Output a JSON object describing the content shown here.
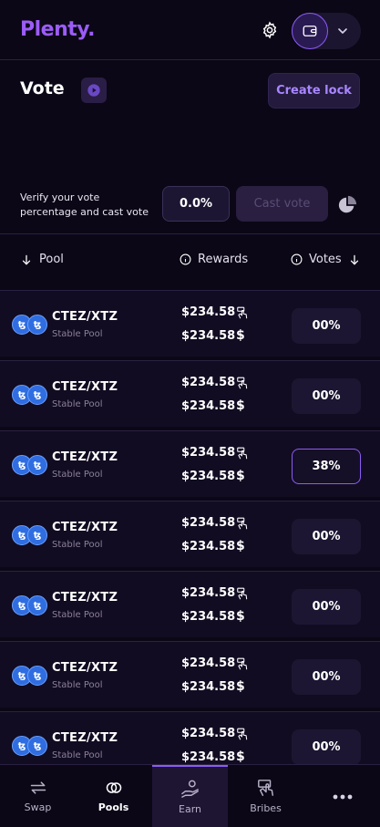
{
  "header": {
    "logo_text": "Plenty.",
    "settings_icon": "gear-icon",
    "wallet_icon": "wallet-icon",
    "dropdown_icon": "chevron-down-icon"
  },
  "vote_bar": {
    "title": "Vote",
    "video_icon": "play-icon",
    "create_lock_label": "Create lock"
  },
  "verify": {
    "text": "Verify your vote percentage and cast vote",
    "percentage": "0.0%",
    "cast_vote_label": "Cast vote",
    "chart_icon": "pie-chart-icon"
  },
  "table": {
    "headers": {
      "pool": "Pool",
      "rewards": "Rewards",
      "votes": "Votes"
    },
    "rows": [
      {
        "pair": "CTEZ/XTZ",
        "type": "Stable Pool",
        "reward_1": "$234.58",
        "reward_2": "$234.58",
        "vote": "00%",
        "active": false
      },
      {
        "pair": "CTEZ/XTZ",
        "type": "Stable Pool",
        "reward_1": "$234.58",
        "reward_2": "$234.58",
        "vote": "00%",
        "active": false
      },
      {
        "pair": "CTEZ/XTZ",
        "type": "Stable Pool",
        "reward_1": "$234.58",
        "reward_2": "$234.58",
        "vote": "38%",
        "active": true
      },
      {
        "pair": "CTEZ/XTZ",
        "type": "Stable Pool",
        "reward_1": "$234.58",
        "reward_2": "$234.58",
        "vote": "00%",
        "active": false
      },
      {
        "pair": "CTEZ/XTZ",
        "type": "Stable Pool",
        "reward_1": "$234.58",
        "reward_2": "$234.58",
        "vote": "00%",
        "active": false
      },
      {
        "pair": "CTEZ/XTZ",
        "type": "Stable Pool",
        "reward_1": "$234.58",
        "reward_2": "$234.58",
        "vote": "00%",
        "active": false
      },
      {
        "pair": "CTEZ/XTZ",
        "type": "Stable Pool",
        "reward_1": "$234.58",
        "reward_2": "$234.58",
        "vote": "00%",
        "active": false
      }
    ]
  },
  "bottom_nav": {
    "items": [
      {
        "label": "Swap",
        "icon": "swap-icon"
      },
      {
        "label": "Pools",
        "icon": "pools-icon"
      },
      {
        "label": "Earn",
        "icon": "earn-icon"
      },
      {
        "label": "Bribes",
        "icon": "bribes-icon"
      },
      {
        "label": "",
        "icon": "more-icon"
      }
    ]
  },
  "colors": {
    "background": "#0b0716",
    "accent": "#8b5cf6",
    "logo": "#9b5cf6",
    "create_lock_text": "#a986ff",
    "token": "#2f6de1"
  }
}
